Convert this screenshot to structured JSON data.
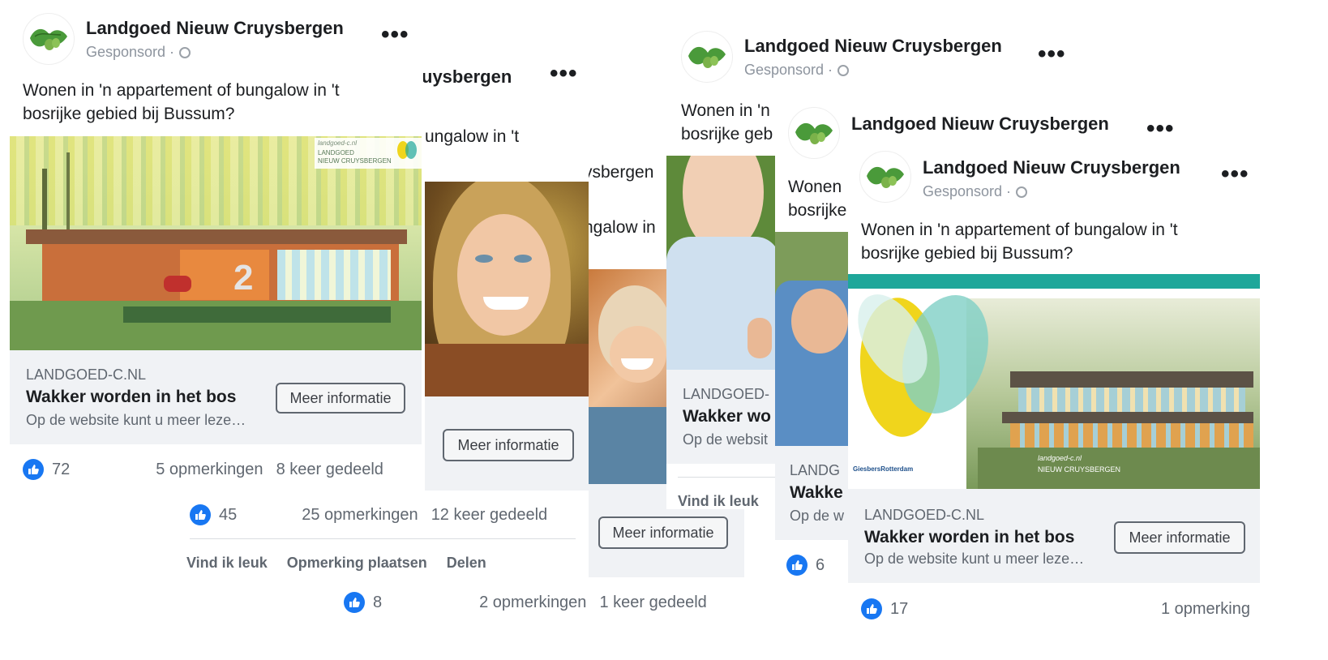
{
  "brand": {
    "facebook_blue": "#1877f2",
    "link_bg": "#f0f2f5",
    "teal": "#1ea79a",
    "yellow": "#f0d51c"
  },
  "page_name": "Landgoed Nieuw Cruysbergen",
  "page_name_fragment": "uysbergen",
  "page_name_fragment_b": "ysbergen",
  "sponsored": "Gesponsord ·",
  "post_text_1": "Wonen in 'n appartement of bungalow in 't",
  "post_text_2": "bosrijke gebied bij Bussum?",
  "post_fragment_a": "ungalow in 't",
  "post_fragment_b": "ngalow in",
  "post_fragment_c1": "Wonen in 'n",
  "post_fragment_c2": "bosrijke geb",
  "post_fragment_d1": "Wonen",
  "post_fragment_d2": "bosrijke",
  "domain": "LANDGOED-C.NL",
  "domain_fragment": "LANDGOED-",
  "domain_fragment_b": "LANDG",
  "headline": "Wakker worden in het bos",
  "headline_fragment": "Wakker wo",
  "headline_fragment_b": "Wakke",
  "description": "Op de website kunt u meer leze…",
  "description_fragment": "Op de websit",
  "description_fragment_b": "Op de w",
  "cta": "Meer informatie",
  "image_logo_line1": "landgoed-c.nl",
  "image_logo_line2": "LANDGOED",
  "image_logo_line3": "NIEUW CRUYSBERGEN",
  "image_number": "2",
  "giesbers": "GiesbersRotterdam",
  "cards": {
    "card1": {
      "likes": "72",
      "comments": "5 opmerkingen",
      "shares": "8 keer gedeeld"
    },
    "card2": {
      "likes": "45",
      "comments": "25 opmerkingen",
      "shares": "12 keer gedeeld"
    },
    "card3": {
      "likes": "8",
      "comments": "2 opmerkingen",
      "shares": "1 keer gedeeld"
    },
    "card5": {
      "likes": "6"
    },
    "card6": {
      "likes": "17",
      "comments": "1 opmerking"
    }
  },
  "actions": {
    "like": "Vind ik leuk",
    "comment": "Opmerking plaatsen",
    "share": "Delen"
  },
  "action_fragment": "Vind ik leuk"
}
